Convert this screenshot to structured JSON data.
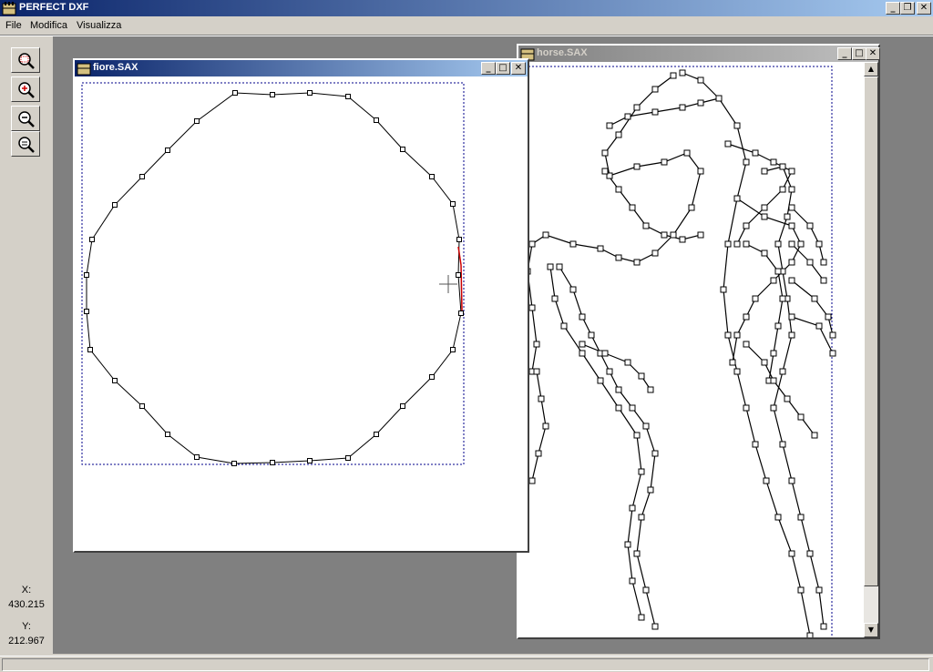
{
  "app": {
    "title": "PERFECT DXF"
  },
  "menu": [
    "File",
    "Modifica",
    "Visualizza"
  ],
  "toolbar": {
    "icons": [
      "zoom-window-icon",
      "zoom-in-icon",
      "zoom-out-icon",
      "zoom-all-icon"
    ]
  },
  "coords": {
    "x_label": "X:",
    "x_value": "430.215",
    "y_label": "Y:",
    "y_value": "212.967"
  },
  "windows": [
    {
      "title": "fiore.SAX",
      "active": true
    },
    {
      "title": "horse.SAX",
      "active": false
    }
  ],
  "colors": {
    "titlebar_active": "#0a246a",
    "titlebar_inactive": "#808080",
    "mdi_background": "#808080",
    "selected_segment": "#cc0000",
    "frame_dash": "#00008b"
  }
}
